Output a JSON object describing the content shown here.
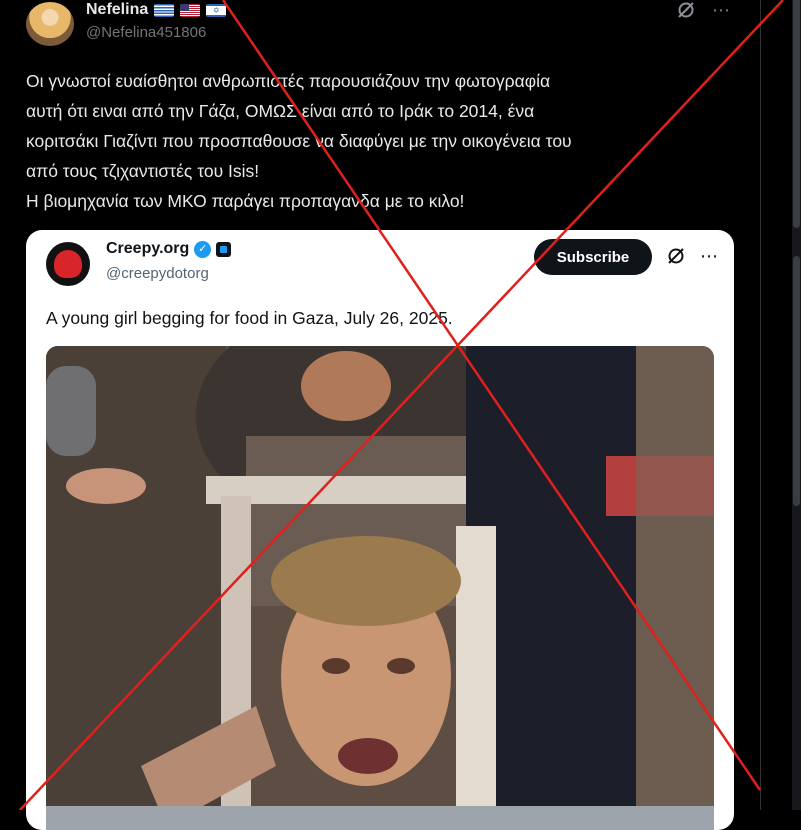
{
  "post": {
    "author_name": "Nefelina",
    "flags": [
      "greece-flag",
      "usa-flag",
      "israel-flag"
    ],
    "handle": "@Nefelina451806",
    "text_lines": [
      "Οι γνωστοί ευαίσθητοι ανθρωπιστές παρουσιάζουν την φωτογραφία",
      "αυτή ότι ειναι από την Γάζα, ΟΜΩΣ είναι από το Ιράκ το 2014, ένα",
      "κοριτσάκι Γιαζίντι που προσπαθουσε να διαφύγει με την οικογένεια του",
      "από τους τζιχαντιστές του Isis!",
      "Η βιομηχανία των ΜΚΟ παράγει προπαγανδα με το κιλο!"
    ],
    "more_icon": "⋯"
  },
  "quote": {
    "author_name": "Creepy.org",
    "handle": "@creepydotorg",
    "subscribe_label": "Subscribe",
    "text": "A young girl begging for food in Gaza, July 26, 2025.",
    "more_icon": "⋯"
  },
  "overlay": {
    "cross_color": "#e0201d"
  }
}
